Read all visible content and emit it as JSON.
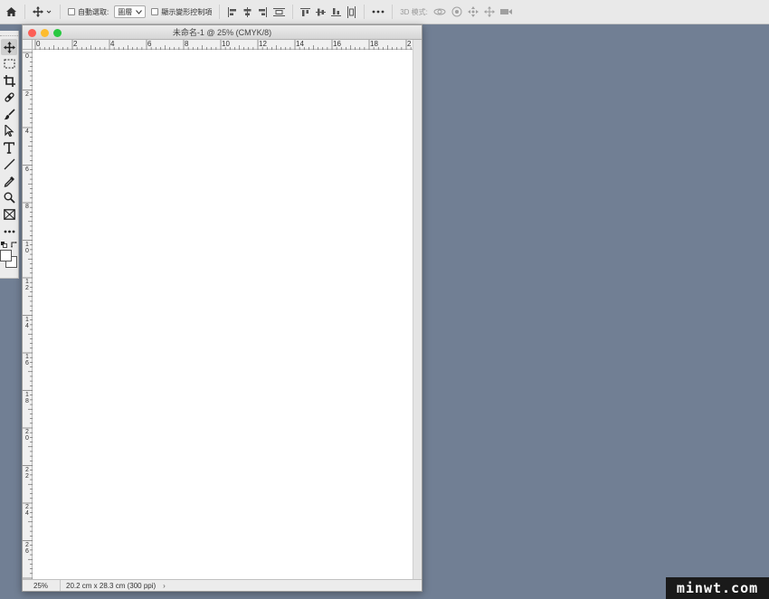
{
  "options_bar": {
    "auto_select_label": "自動選取:",
    "layer_select_value": "圖層",
    "show_transform_label": "顯示變形控制項",
    "mode_3d_label": "3D 模式:"
  },
  "tools": [
    {
      "name": "move-tool",
      "icon": "move-icon"
    },
    {
      "name": "marquee-tool",
      "icon": "marquee-icon"
    },
    {
      "name": "crop-tool",
      "icon": "crop-icon"
    },
    {
      "name": "healing-tool",
      "icon": "bandage-icon"
    },
    {
      "name": "brush-tool",
      "icon": "brush-icon"
    },
    {
      "name": "path-select-tool",
      "icon": "arrow-icon"
    },
    {
      "name": "type-tool",
      "icon": "type-icon"
    },
    {
      "name": "line-tool",
      "icon": "line-icon"
    },
    {
      "name": "eyedropper-tool",
      "icon": "eyedropper-icon"
    },
    {
      "name": "zoom-tool",
      "icon": "magnifier-icon"
    },
    {
      "name": "frame-tool",
      "icon": "frame-icon"
    },
    {
      "name": "more-tools",
      "icon": "ellipsis-icon"
    }
  ],
  "document": {
    "title": "未命名-1 @ 25% (CMYK/8)",
    "ruler_top": [
      "0",
      "2",
      "4",
      "6",
      "8",
      "10",
      "12",
      "14",
      "16",
      "18",
      "2"
    ],
    "ruler_left": [
      "0",
      "2",
      "4",
      "6",
      "8",
      "1\n0",
      "1\n2",
      "1\n4",
      "1\n6",
      "1\n8",
      "2\n0",
      "2\n2",
      "2\n4",
      "2\n6"
    ],
    "zoom": "25%",
    "doc_info": "20.2 cm x 28.3 cm (300 ppi)",
    "status_arrow": "›"
  },
  "colors": {
    "workspace": "#717f94",
    "close": "#fc5f57",
    "minimize": "#fdbc2e",
    "zoom": "#28c840"
  },
  "watermark": "minwt.com"
}
